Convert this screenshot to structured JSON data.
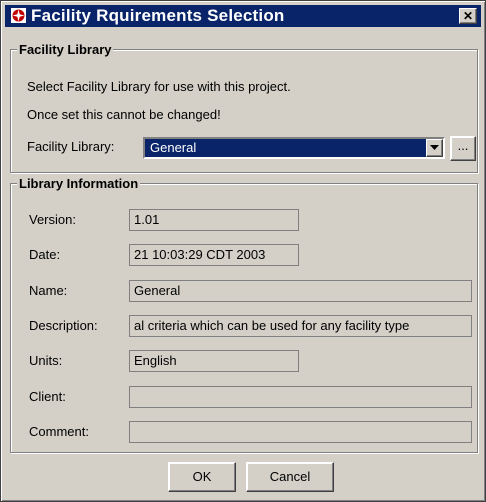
{
  "window": {
    "title": "Facility Rquirements Selection",
    "close_label": "✕"
  },
  "facility_library": {
    "legend": "Facility Library",
    "instruction_1": "Select Facility Library for use with this project.",
    "instruction_2": "Once set this cannot be changed!",
    "select_label": "Facility Library:",
    "selected_value": "General",
    "browse_label": "..."
  },
  "library_info": {
    "legend": "Library Information",
    "fields": [
      {
        "label": "Version:",
        "value": "1.01"
      },
      {
        "label": "Date:",
        "value": "21 10:03:29 CDT 2003"
      },
      {
        "label": "Name:",
        "value": "General"
      },
      {
        "label": "Description:",
        "value": "al criteria which can be used for any facility type"
      },
      {
        "label": "Units:",
        "value": "English"
      },
      {
        "label": "Client:",
        "value": ""
      },
      {
        "label": "Comment:",
        "value": ""
      }
    ]
  },
  "buttons": {
    "ok_label": "OK",
    "cancel_label": "Cancel"
  },
  "colors": {
    "title_bar": "#0a246a",
    "dialog_bg": "#d4d0c8"
  },
  "icons": {
    "app": "compass-icon",
    "close": "close-icon",
    "dropdown": "chevron-down-icon"
  }
}
